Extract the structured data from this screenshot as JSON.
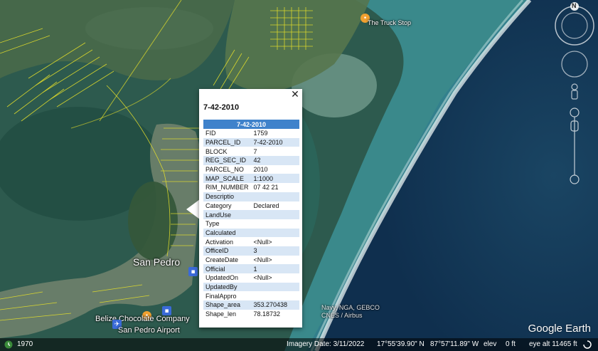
{
  "map": {
    "labels": {
      "truck_stop": "The Truck Stop",
      "san_pedro": "San Pedro",
      "chocolate_company": "Belize Chocolate Company",
      "airport": "San Pedro Airport"
    },
    "copyright": "Navy, NGA, GEBCO\nCNES / Airbus"
  },
  "nav": {
    "compass_label": "N"
  },
  "popup": {
    "title": "7-42-2010",
    "table_header": "7-42-2010",
    "close_label": "✕",
    "rows": [
      {
        "key": "FID",
        "value": "1759"
      },
      {
        "key": "PARCEL_ID",
        "value": "7-42-2010"
      },
      {
        "key": "BLOCK",
        "value": "7"
      },
      {
        "key": "REG_SEC_ID",
        "value": "42"
      },
      {
        "key": "PARCEL_NO",
        "value": "2010"
      },
      {
        "key": "MAP_SCALE",
        "value": "1:1000"
      },
      {
        "key": "RIM_NUMBER",
        "value": "07 42 21"
      },
      {
        "key": "Descriptio",
        "value": ""
      },
      {
        "key": "Category",
        "value": "Declared"
      },
      {
        "key": "LandUse",
        "value": ""
      },
      {
        "key": "Type",
        "value": ""
      },
      {
        "key": "Calculated",
        "value": ""
      },
      {
        "key": "Activation",
        "value": "<Null>"
      },
      {
        "key": "OfficeID",
        "value": "3"
      },
      {
        "key": "CreateDate",
        "value": "<Null>"
      },
      {
        "key": "Official",
        "value": "1"
      },
      {
        "key": "UpdatedOn",
        "value": "<Null>"
      },
      {
        "key": "UpdatedBy",
        "value": ""
      },
      {
        "key": "FinalAppro",
        "value": ""
      },
      {
        "key": "Shape_area",
        "value": "353.270438"
      },
      {
        "key": "Shape_len",
        "value": "78.18732"
      }
    ]
  },
  "statusbar": {
    "year": "1970",
    "imagery_date": "Imagery Date: 3/11/2022",
    "lat": "17°55'39.90\" N",
    "lon": "87°57'11.89\" W",
    "elev": "elev",
    "elev_value": "0 ft",
    "eye_alt": "eye alt  11465 ft"
  },
  "logo": "Google Earth",
  "colors": {
    "header_blue": "#3f82cb",
    "row_alt": "#d8e6f5",
    "parcel_lines": "#e6e02a"
  }
}
